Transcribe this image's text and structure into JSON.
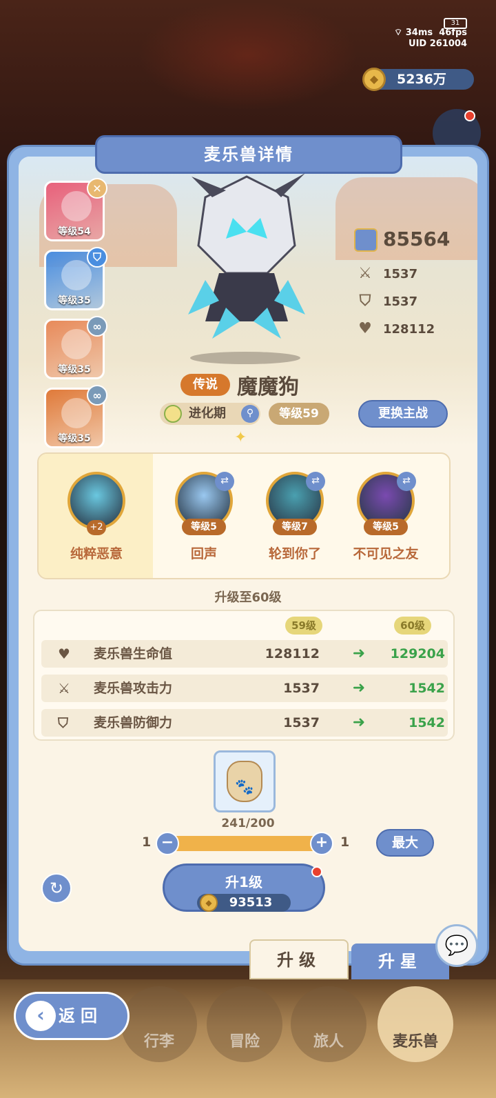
{
  "status": {
    "battery": "31",
    "ping": "34ms",
    "fps": "46fps",
    "uid": "UID 261004"
  },
  "currency": {
    "amount": "5236万"
  },
  "panel": {
    "title": "麦乐兽详情"
  },
  "team": [
    {
      "level": "等级54",
      "badge": "✕",
      "color": "#e8607a",
      "badge_color": "#e8b870"
    },
    {
      "level": "等级35",
      "badge": "⛉",
      "color": "#4a8ee0",
      "badge_color": "#4a8ee0"
    },
    {
      "level": "等级35",
      "badge": "∞",
      "color": "#e88a5a",
      "badge_color": "#7a9ab8"
    },
    {
      "level": "等级35",
      "badge": "∞",
      "color": "#e07a3a",
      "badge_color": "#7a9ab8"
    }
  ],
  "pet": {
    "rarity": "传说",
    "name": "魔魔狗",
    "evolution": "进化期",
    "level": "等级59",
    "power": "85564",
    "attack": "1537",
    "defense": "1537",
    "hp": "128112"
  },
  "actions": {
    "swap_main": "更换主战"
  },
  "skills": [
    {
      "name": "纯粹恶意",
      "level": "+2",
      "color": "#6ac8e0"
    },
    {
      "name": "回声",
      "level": "等级5",
      "color": "#9ac8f0"
    },
    {
      "name": "轮到你了",
      "level": "等级7",
      "color": "#4aa0b0"
    },
    {
      "name": "不可见之友",
      "level": "等级5",
      "color": "#7a4ab0"
    }
  ],
  "upgrade": {
    "title": "升级至60级",
    "from_label": "59级",
    "to_label": "60级",
    "rows": [
      {
        "label": "麦乐兽生命值",
        "from": "128112",
        "to": "129204"
      },
      {
        "label": "麦乐兽攻击力",
        "from": "1537",
        "to": "1542"
      },
      {
        "label": "麦乐兽防御力",
        "from": "1537",
        "to": "1542"
      }
    ],
    "item_count": "241/200",
    "qty_min": "1",
    "qty_max": "1",
    "max_label": "最大",
    "button_label": "升1级",
    "cost": "93513"
  },
  "tabs": {
    "level_up": "升级",
    "star_up": "升星"
  },
  "nav": {
    "back": "返回",
    "items": [
      "行李",
      "冒险",
      "旅人",
      "麦乐兽"
    ]
  }
}
